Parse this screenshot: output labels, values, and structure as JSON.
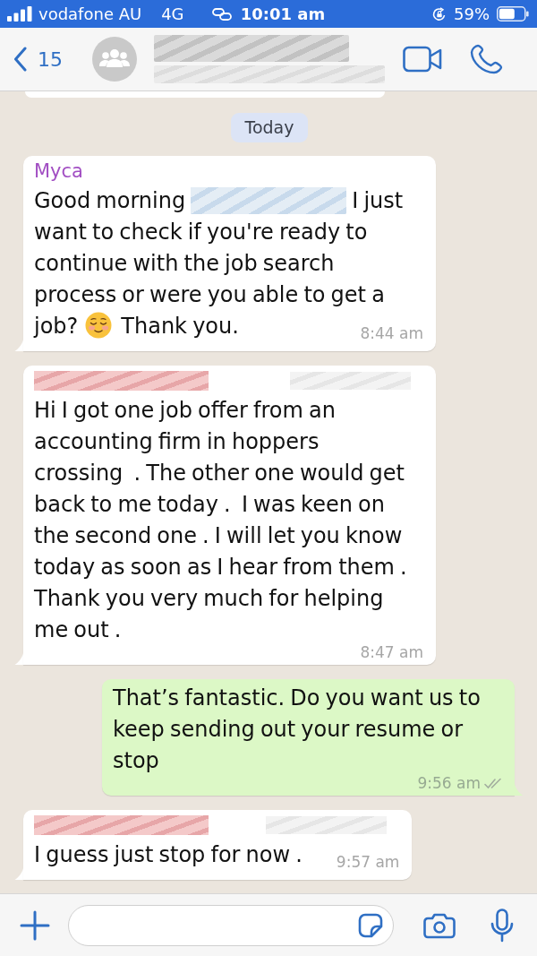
{
  "status_bar": {
    "carrier": "vodafone AU",
    "network": "4G",
    "time": "10:01 am",
    "battery": "59%"
  },
  "header": {
    "back_count": "15",
    "title_redacted": true
  },
  "chat": {
    "clipped_message_above": true,
    "date_chip": "Today",
    "messages": [
      {
        "outgoing": false,
        "sender": "Myca",
        "parts": [
          {
            "kind": "text",
            "text": "Good morning"
          },
          {
            "kind": "redaction"
          },
          {
            "kind": "text",
            "text": "I just"
          },
          {
            "kind": "paragraph",
            "text": "want to check if you're ready to continue with the job search process or were you able to get a"
          },
          {
            "kind": "text",
            "text": "job?"
          },
          {
            "kind": "emoji"
          },
          {
            "kind": "text",
            "text": "Thank you."
          }
        ],
        "time": "8:44 am"
      },
      {
        "outgoing": false,
        "sender_redacted": true,
        "parts": [
          {
            "kind": "paragraph",
            "text": "Hi I got one job offer from an accounting firm in hoppers crossing  . The other one would get back to me today .  I was keen on the second one . I will let you know today as soon as I hear from them . Thank you very much for helping me out ."
          }
        ],
        "time": "8:47 am"
      },
      {
        "outgoing": true,
        "parts": [
          {
            "kind": "paragraph",
            "text": "That’s fantastic. Do you want us to keep sending out your resume or stop"
          }
        ],
        "time": "9:56 am",
        "read": false
      },
      {
        "outgoing": false,
        "sender_redacted": true,
        "parts": [
          {
            "kind": "text",
            "text": "I guess just stop for now ."
          }
        ],
        "time": "9:57 am"
      }
    ]
  }
}
